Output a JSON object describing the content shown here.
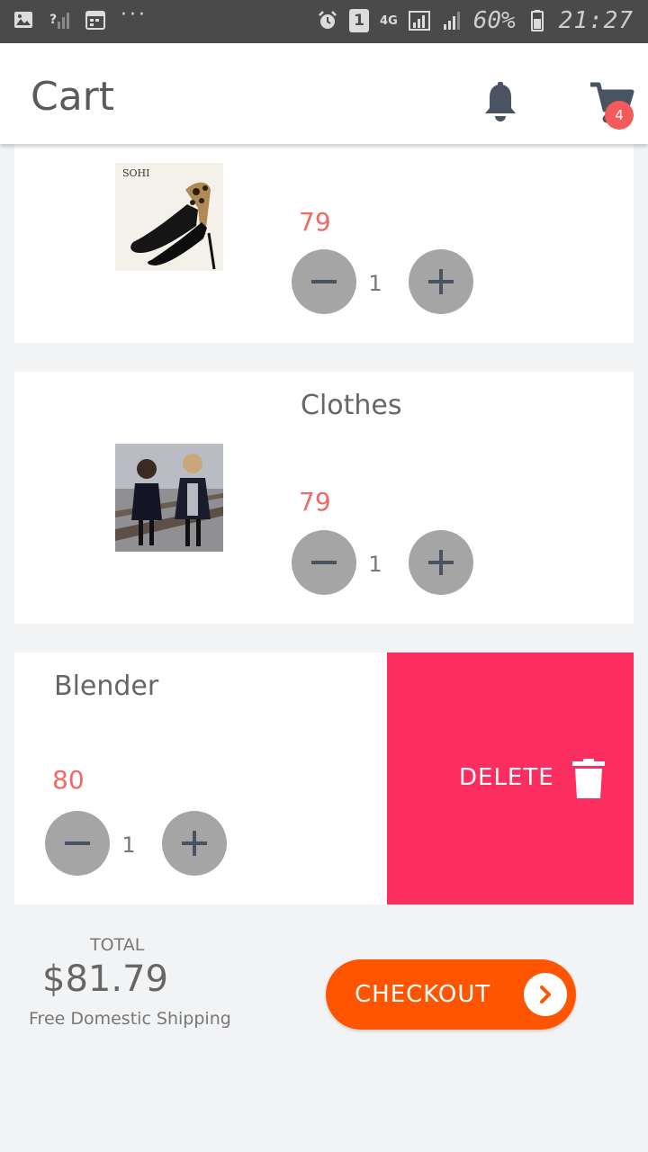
{
  "status_bar": {
    "battery_text": "60%",
    "time": "21:27",
    "sim_slot": "1",
    "network": "4G"
  },
  "header": {
    "title": "Cart",
    "cart_badge": "4"
  },
  "items": [
    {
      "name": "",
      "price": "79",
      "quantity": "1",
      "image": "black-high-heel-shoes"
    },
    {
      "name": "Clothes",
      "price": "79",
      "quantity": "1",
      "image": "girls-in-coats"
    },
    {
      "name": "Blender",
      "price": "80",
      "quantity": "1",
      "image": ""
    }
  ],
  "swipe_action": {
    "label": "DELETE",
    "color": "#fc2d5f"
  },
  "summary": {
    "total_label": "TOTAL",
    "total_amount": "$81.79",
    "shipping_note": "Free Domestic Shipping",
    "checkout_label": "CHECKOUT"
  },
  "colors": {
    "accent": "#ff5500",
    "price": "#ee6a66",
    "badge": "#f35b5b",
    "stepper": "#a5a5a5"
  }
}
